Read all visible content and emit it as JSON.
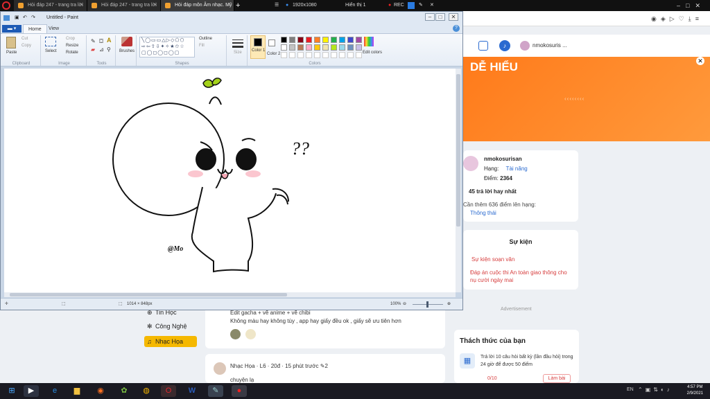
{
  "browser": {
    "tabs": [
      {
        "label": "Hỏi đáp 247 - trang tra lời"
      },
      {
        "label": "Hỏi đáp 247 - trang tra lời"
      },
      {
        "label": "Hỏi đáp môn Âm nhạc. Mỹ"
      }
    ],
    "new_tab": "+",
    "recorder": {
      "resolution": "1920x1080",
      "display": "Hiển thị 1",
      "rec": "REC"
    },
    "toolbar_icons": [
      "minimize-icon",
      "maximize-icon",
      "close-icon"
    ]
  },
  "paint": {
    "title": "Untitled - Paint",
    "tabs": [
      "Home",
      "View"
    ],
    "file_menu": "▾",
    "groups": {
      "clipboard": {
        "label": "Clipboard",
        "paste": "Paste",
        "cut": "Cut",
        "copy": "Copy"
      },
      "image": {
        "label": "Image",
        "select": "Select",
        "crop": "Crop",
        "resize": "Resize",
        "rotate": "Rotate"
      },
      "tools": {
        "label": "Tools",
        "brushes": "Brushes"
      },
      "shapes": {
        "label": "Shapes",
        "outline": "Outline",
        "fill": "Fill"
      },
      "colors": {
        "label": "Colors",
        "size": "Size",
        "color1": "Color 1",
        "color2": "Color 2",
        "edit": "Edit colors"
      }
    },
    "palette_row1": [
      "#000000",
      "#7f7f7f",
      "#880015",
      "#ed1c24",
      "#ff7f27",
      "#fff200",
      "#22b14c",
      "#00a2e8",
      "#3f48cc",
      "#a349a4"
    ],
    "palette_row2": [
      "#ffffff",
      "#c3c3c3",
      "#b97a57",
      "#ffaec9",
      "#ffc90e",
      "#efe4b0",
      "#b5e61d",
      "#99d9ea",
      "#7092be",
      "#c8bfe7"
    ],
    "drawing": {
      "question": "??",
      "signature": "@Mo"
    },
    "status": {
      "size": "1014 × 848px",
      "zoom": "100%"
    }
  },
  "site": {
    "header_user": "nmokosuris ...",
    "banner_title": "DỄ HIỂU",
    "profile": {
      "name": "nmokosurisan",
      "rank_label": "Hạng:",
      "rank_value": "Tài năng",
      "points_label": "Điểm:",
      "points_value": "2364",
      "best_answers": "45 trả lời hay nhất",
      "next_rank": "Cần thêm 636 điểm lên hạng:",
      "next_rank_value": "Thông thái"
    },
    "events": {
      "title": "Sự kiện",
      "items": [
        "Sự kiện soạn văn",
        "Đáp án cuộc thi An toàn giao thông cho nụ cười ngày mai"
      ]
    },
    "advert": "Advertisement",
    "challenge": {
      "title": "Thách thức của bạn",
      "text": "Trả lời 10 câu hỏi bất kỳ (lần đầu hỏi) trong 24 giờ để được 50 điểm",
      "progress": "0/10",
      "button": "Làm bài"
    },
    "sidebar": [
      {
        "label": "Tin Học"
      },
      {
        "label": "Công Nghệ"
      },
      {
        "label": "Nhạc Họa"
      }
    ],
    "post1": {
      "line1": "Edit gacha + vẽ anime + vẽ chibi",
      "line2": "Không màu hay không tùy , app hay giấy đều ok , giấy sẽ ưu tiên hơn"
    },
    "post2": {
      "meta": "Nhạc Họa · L6 · 20đ · 15 phút trước",
      "comments": "2",
      "text": "chuyện lạ"
    }
  },
  "taskbar": {
    "clock_time": "4:57 PM",
    "clock_date": "2/9/2021",
    "lang": "EN"
  },
  "colors": {
    "accent_orange": "#ff8a2a",
    "paint_blue": "#1e5bb5",
    "site_link_red": "#d63c3c"
  }
}
